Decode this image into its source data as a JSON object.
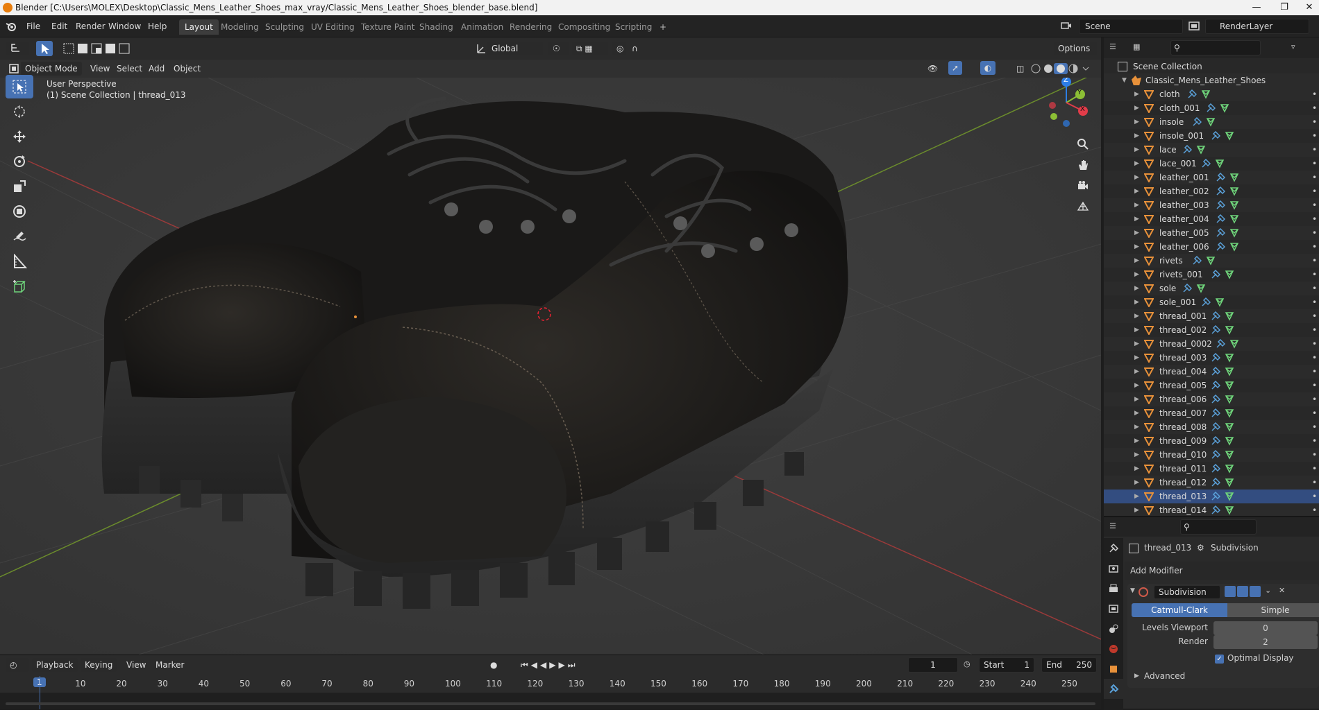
{
  "window": {
    "title": "Blender [C:\\Users\\MOLEX\\Desktop\\Classic_Mens_Leather_Shoes_max_vray/Classic_Mens_Leather_Shoes_blender_base.blend]"
  },
  "menus": [
    "File",
    "Edit",
    "Render",
    "Window",
    "Help"
  ],
  "workspaces": [
    "Layout",
    "Modeling",
    "Sculpting",
    "UV Editing",
    "Texture Paint",
    "Shading",
    "Animation",
    "Rendering",
    "Compositing",
    "Scripting"
  ],
  "scene": {
    "name": "Scene",
    "render_layer": "RenderLayer"
  },
  "header": {
    "transform": "Global",
    "options": "Options"
  },
  "viewport_header": {
    "mode": "Object Mode",
    "menus": [
      "View",
      "Select",
      "Add",
      "Object"
    ]
  },
  "viewport": {
    "perspective": "User Perspective",
    "collection": "(1) Scene Collection | thread_013"
  },
  "gizmo": {
    "x": "X",
    "y": "Y",
    "z": "Z"
  },
  "outliner": {
    "root": "Scene Collection",
    "collection": "Classic_Mens_Leather_Shoes",
    "objects": [
      "cloth",
      "cloth_001",
      "insole",
      "insole_001",
      "lace",
      "lace_001",
      "leather_001",
      "leather_002",
      "leather_003",
      "leather_004",
      "leather_005",
      "leather_006",
      "rivets",
      "rivets_001",
      "sole",
      "sole_001",
      "thread_001",
      "thread_002",
      "thread_0002",
      "thread_003",
      "thread_004",
      "thread_005",
      "thread_006",
      "thread_007",
      "thread_008",
      "thread_009",
      "thread_010",
      "thread_011",
      "thread_012",
      "thread_013",
      "thread_014"
    ],
    "selected": "thread_013"
  },
  "properties": {
    "object": "thread_013",
    "modifier_context": "Subdivision",
    "add_modifier": "Add Modifier",
    "modifier_name": "Subdivision",
    "method_a": "Catmull-Clark",
    "method_b": "Simple",
    "levels_viewport_label": "Levels Viewport",
    "levels_viewport": "0",
    "render_label": "Render",
    "render_value": "2",
    "optimal_display": "Optimal Display",
    "advanced": "Advanced"
  },
  "timeline": {
    "menus": [
      "Playback",
      "Keying",
      "View",
      "Marker"
    ],
    "current_frame": "1",
    "start_label": "Start",
    "start": "1",
    "end_label": "End",
    "end": "250",
    "ruler_marks": [
      "1",
      "10",
      "20",
      "30",
      "40",
      "50",
      "60",
      "70",
      "80",
      "90",
      "100",
      "110",
      "120",
      "130",
      "140",
      "150",
      "160",
      "170",
      "180",
      "190",
      "200",
      "210",
      "220",
      "230",
      "240",
      "250"
    ]
  },
  "colors": {
    "accent": "#4772b3",
    "orange": "#e87d0d",
    "mesh_icon": "#e8913a",
    "modifier_icon": "#5aa0d8",
    "data_icon": "#6fd47b"
  }
}
